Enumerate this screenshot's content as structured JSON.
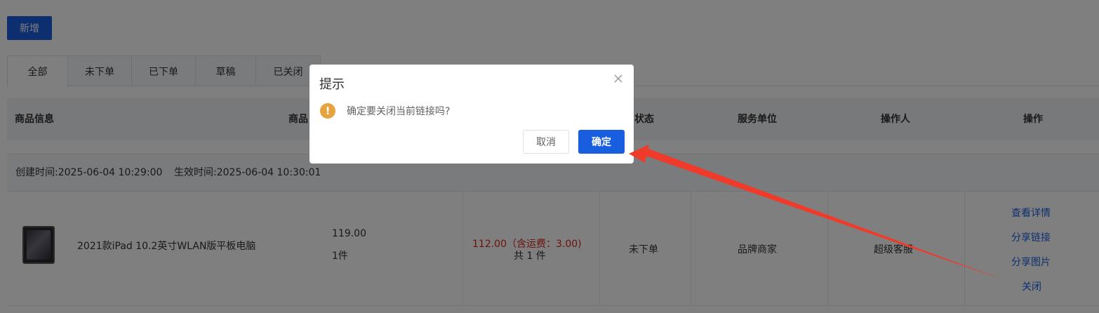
{
  "toolbar": {
    "add_label": "新增"
  },
  "tabs": [
    {
      "label": "全部",
      "active": true
    },
    {
      "label": "未下单",
      "active": false
    },
    {
      "label": "已下单",
      "active": false
    },
    {
      "label": "草稿",
      "active": false
    },
    {
      "label": "已关闭",
      "active": false
    }
  ],
  "table": {
    "headers": [
      "商品信息",
      "商品",
      "状态",
      "服务单位",
      "操作人",
      "操作"
    ],
    "order": {
      "created_label": "创建时间:2025-06-04 10:29:00",
      "effective_label": "生效时间:2025-06-04 10:30:01",
      "product_name": "2021款iPad 10.2英寸WLAN版平板电脑",
      "unit_price": "119.00",
      "quantity": "1件",
      "total_line": "112.00（含运费：3.00)",
      "total_count": "共 1 件",
      "status": "未下单",
      "service_unit": "品牌商家",
      "operator": "超级客服",
      "actions": {
        "view_detail": "查看详情",
        "share_link": "分享链接",
        "share_image": "分享图片",
        "close": "关闭"
      }
    }
  },
  "dialog": {
    "title": "提示",
    "message": "确定要关闭当前链接吗?",
    "warning_glyph": "!",
    "cancel_label": "取消",
    "confirm_label": "确定"
  },
  "colors": {
    "primary": "#1a5ee0",
    "warning": "#e6a23c",
    "price_red": "#d9251c",
    "annotation_arrow": "#f03a2a"
  }
}
